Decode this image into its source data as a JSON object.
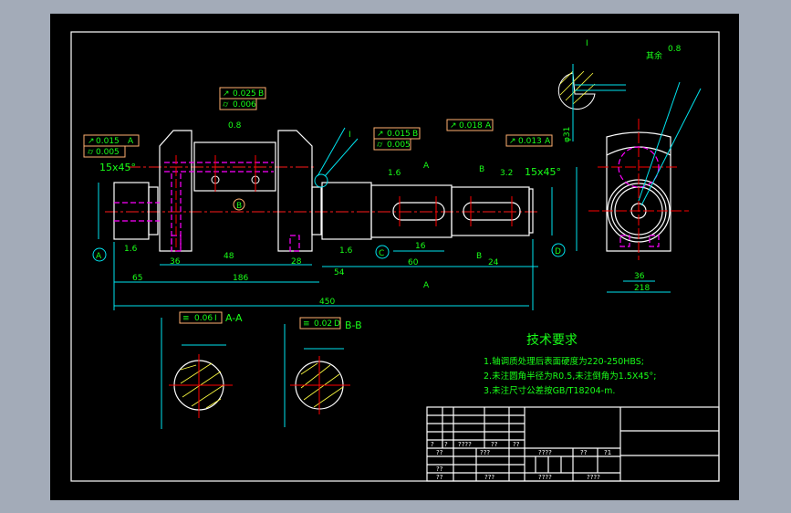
{
  "drawing": {
    "tech_req_title": "技术要求",
    "tech_req": [
      "1.轴调质处理后表面硬度为220-250HBS;",
      "2.未注圆角半径为R0.5,未注倒角为1.5X45°;",
      "3.未注尺寸公差按GB/T18204-m."
    ],
    "chamfer_left": "15x45°",
    "chamfer_right": "15x45°",
    "section_aa": "A-A",
    "section_bb": "B-B",
    "datums": [
      "A",
      "B",
      "C",
      "D"
    ],
    "cut_labels": [
      "A",
      "A",
      "B",
      "B",
      "I",
      "I"
    ],
    "dia_label": "φ31",
    "roughness": [
      "1.6",
      "0.8",
      "1.6",
      "1.6",
      "3.2",
      "0.8",
      "1.6"
    ],
    "other_roughness": "其余",
    "tol_frames": [
      {
        "sym": "↗",
        "val": "0.015",
        "ref": "A"
      },
      {
        "sym": "⌭",
        "val": "0.005"
      },
      {
        "sym": "↗",
        "val": "0.025",
        "ref": "B"
      },
      {
        "sym": "⌭",
        "val": "0.006"
      },
      {
        "sym": "↗",
        "val": "0.015",
        "ref": "B"
      },
      {
        "sym": "⌭",
        "val": "0.005"
      },
      {
        "sym": "↗",
        "val": "0.018",
        "ref": "A"
      },
      {
        "sym": "↗",
        "val": "0.013",
        "ref": "A"
      },
      {
        "sym": "≡",
        "val": "0.06",
        "ref": "I"
      },
      {
        "sym": "≡",
        "val": "0.02",
        "ref": "D"
      }
    ],
    "dims": [
      "65",
      "186",
      "450",
      "36",
      "28",
      "60",
      "16",
      "24",
      "48",
      "36",
      "218",
      "54"
    ]
  },
  "title_block": {
    "cells": [
      "?",
      "?",
      "????",
      "??",
      "??",
      "??",
      "???",
      "????",
      "??",
      "?1",
      "??",
      "??",
      "???",
      "????",
      "????"
    ]
  }
}
